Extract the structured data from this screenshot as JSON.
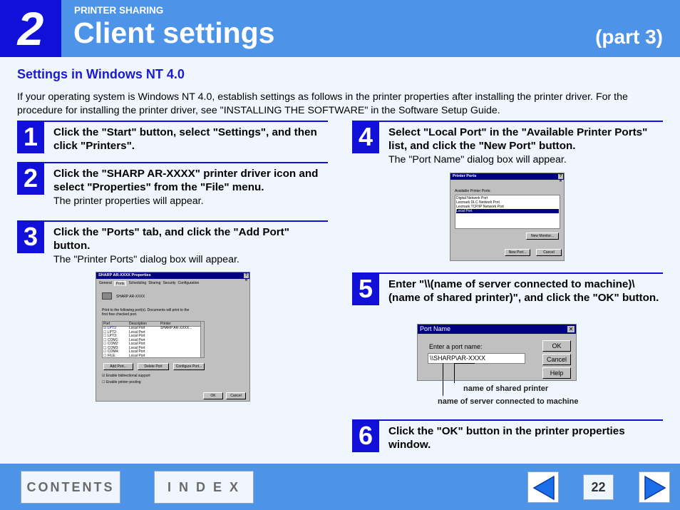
{
  "header": {
    "chapter_number": "2",
    "section": "PRINTER SHARING",
    "title": "Client settings",
    "part": "(part 3)"
  },
  "subtitle": "Settings in Windows NT 4.0",
  "intro": "If your operating system is Windows NT 4.0, establish settings as follows in the printer properties after installing the printer driver. For the procedure for installing the printer driver, see \"INSTALLING THE SOFTWARE\" in the Software Setup Guide.",
  "steps": [
    {
      "num": "1",
      "text": "Click the \"Start\" button, select \"Settings\", and then click \"Printers\".",
      "desc": ""
    },
    {
      "num": "2",
      "text": "Click the \"SHARP AR-XXXX\" printer driver icon and select \"Properties\" from the \"File\" menu.",
      "desc": "The printer properties will appear."
    },
    {
      "num": "3",
      "text": "Click the \"Ports\" tab, and click the \"Add Port\" button.",
      "desc": "The \"Printer Ports\" dialog box will appear."
    },
    {
      "num": "4",
      "text": "Select \"Local Port\" in the \"Available Printer Ports\" list, and click the \"New Port\" button.",
      "desc": "The \"Port Name\" dialog box will appear."
    },
    {
      "num": "5",
      "text": "Enter \"\\\\(name of server connected to machine)\\(name of shared printer)\", and click the \"OK\" button.",
      "desc": ""
    },
    {
      "num": "6",
      "text": "Click the \"OK\" button in the printer properties window.",
      "desc": ""
    }
  ],
  "props_dialog": {
    "title": "SHARP AR-XXXX Properties",
    "tabs": [
      "General",
      "Ports",
      "Scheduling",
      "Sharing",
      "Security",
      "Configuration"
    ],
    "printer_name": "SHARP AR-XXXX",
    "print_to_text": "Print to the following port(s). Documents will print to the first free checked port.",
    "columns": [
      "Port",
      "Description",
      "Printer"
    ],
    "ports": [
      [
        "LPT1:",
        "Local Port",
        "SHARP AR-XXXX..."
      ],
      [
        "LPT2:",
        "Local Port",
        ""
      ],
      [
        "LPT3:",
        "Local Port",
        ""
      ],
      [
        "COM1:",
        "Local Port",
        ""
      ],
      [
        "COM2:",
        "Local Port",
        ""
      ],
      [
        "COM3:",
        "Local Port",
        ""
      ],
      [
        "COM4:",
        "Local Port",
        ""
      ],
      [
        "FILE:",
        "Local Port",
        ""
      ]
    ],
    "add_port": "Add Port...",
    "delete_port": "Delete Port",
    "configure_port": "Configure Port...",
    "bidi": "Enable bidirectional support",
    "pooling": "Enable printer pooling",
    "ok": "OK",
    "cancel": "Cancel"
  },
  "ports_dialog": {
    "title": "Printer Ports",
    "label": "Available Printer Ports:",
    "items": [
      "Digital Network Port",
      "Lexmark DLC Network Port",
      "Lexmark TCP/IP Network Port",
      "Local Port"
    ],
    "new_monitor": "New Monitor...",
    "new_port": "New Port...",
    "cancel": "Cancel"
  },
  "port_name_dialog": {
    "title": "Port Name",
    "label": "Enter a port name:",
    "value": "\\\\SHARP\\AR-XXXX",
    "ok": "OK",
    "cancel": "Cancel",
    "help": "Help"
  },
  "callouts": {
    "shared_printer": "name of shared printer",
    "server": "name of server connected to machine"
  },
  "footer": {
    "contents": "CONTENTS",
    "index": "I N D E X",
    "page": "22"
  },
  "colors": {
    "header_blue": "#4d93e8",
    "dark_blue": "#1010d8",
    "page_bg": "#f0f6fe"
  }
}
